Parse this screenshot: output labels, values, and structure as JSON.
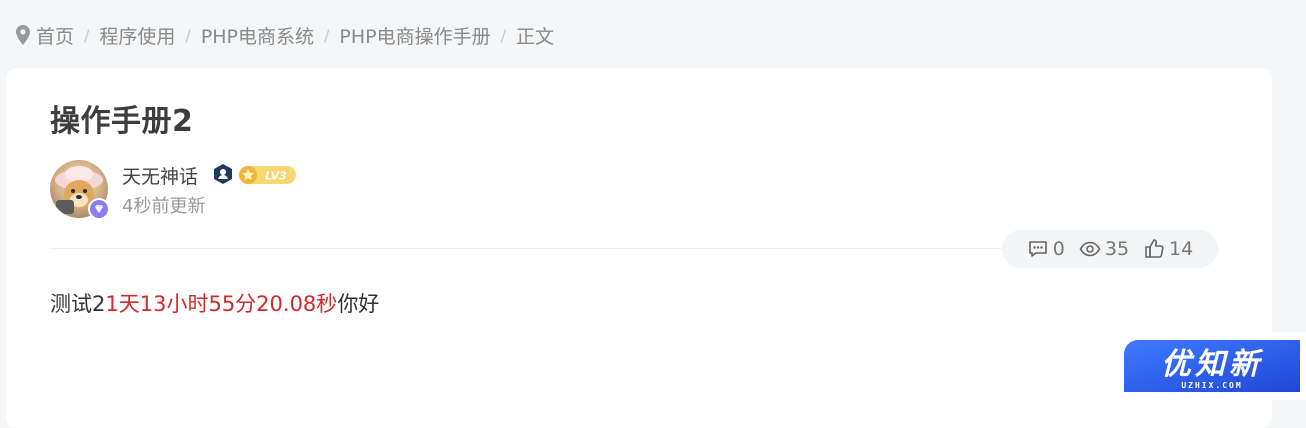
{
  "breadcrumb": {
    "items": [
      "首页",
      "程序使用",
      "PHP电商系统",
      "PHP电商操作手册",
      "正文"
    ],
    "separator": "/"
  },
  "article": {
    "title": "操作手册2",
    "author": {
      "name": "天无神话",
      "level": "LV3",
      "updated": "4秒前更新"
    },
    "stats": {
      "comments": "0",
      "views": "35",
      "likes": "14"
    },
    "content": {
      "prefix": "测试2",
      "highlight": "1天13小时55分20.08秒",
      "suffix": "你好"
    }
  },
  "watermark": {
    "text": "优知新",
    "domain": "UZHIX.COM"
  },
  "colors": {
    "highlight": "#d02a2a",
    "level_badge": "#f5c542",
    "logo_blue": "#2b5be8"
  }
}
